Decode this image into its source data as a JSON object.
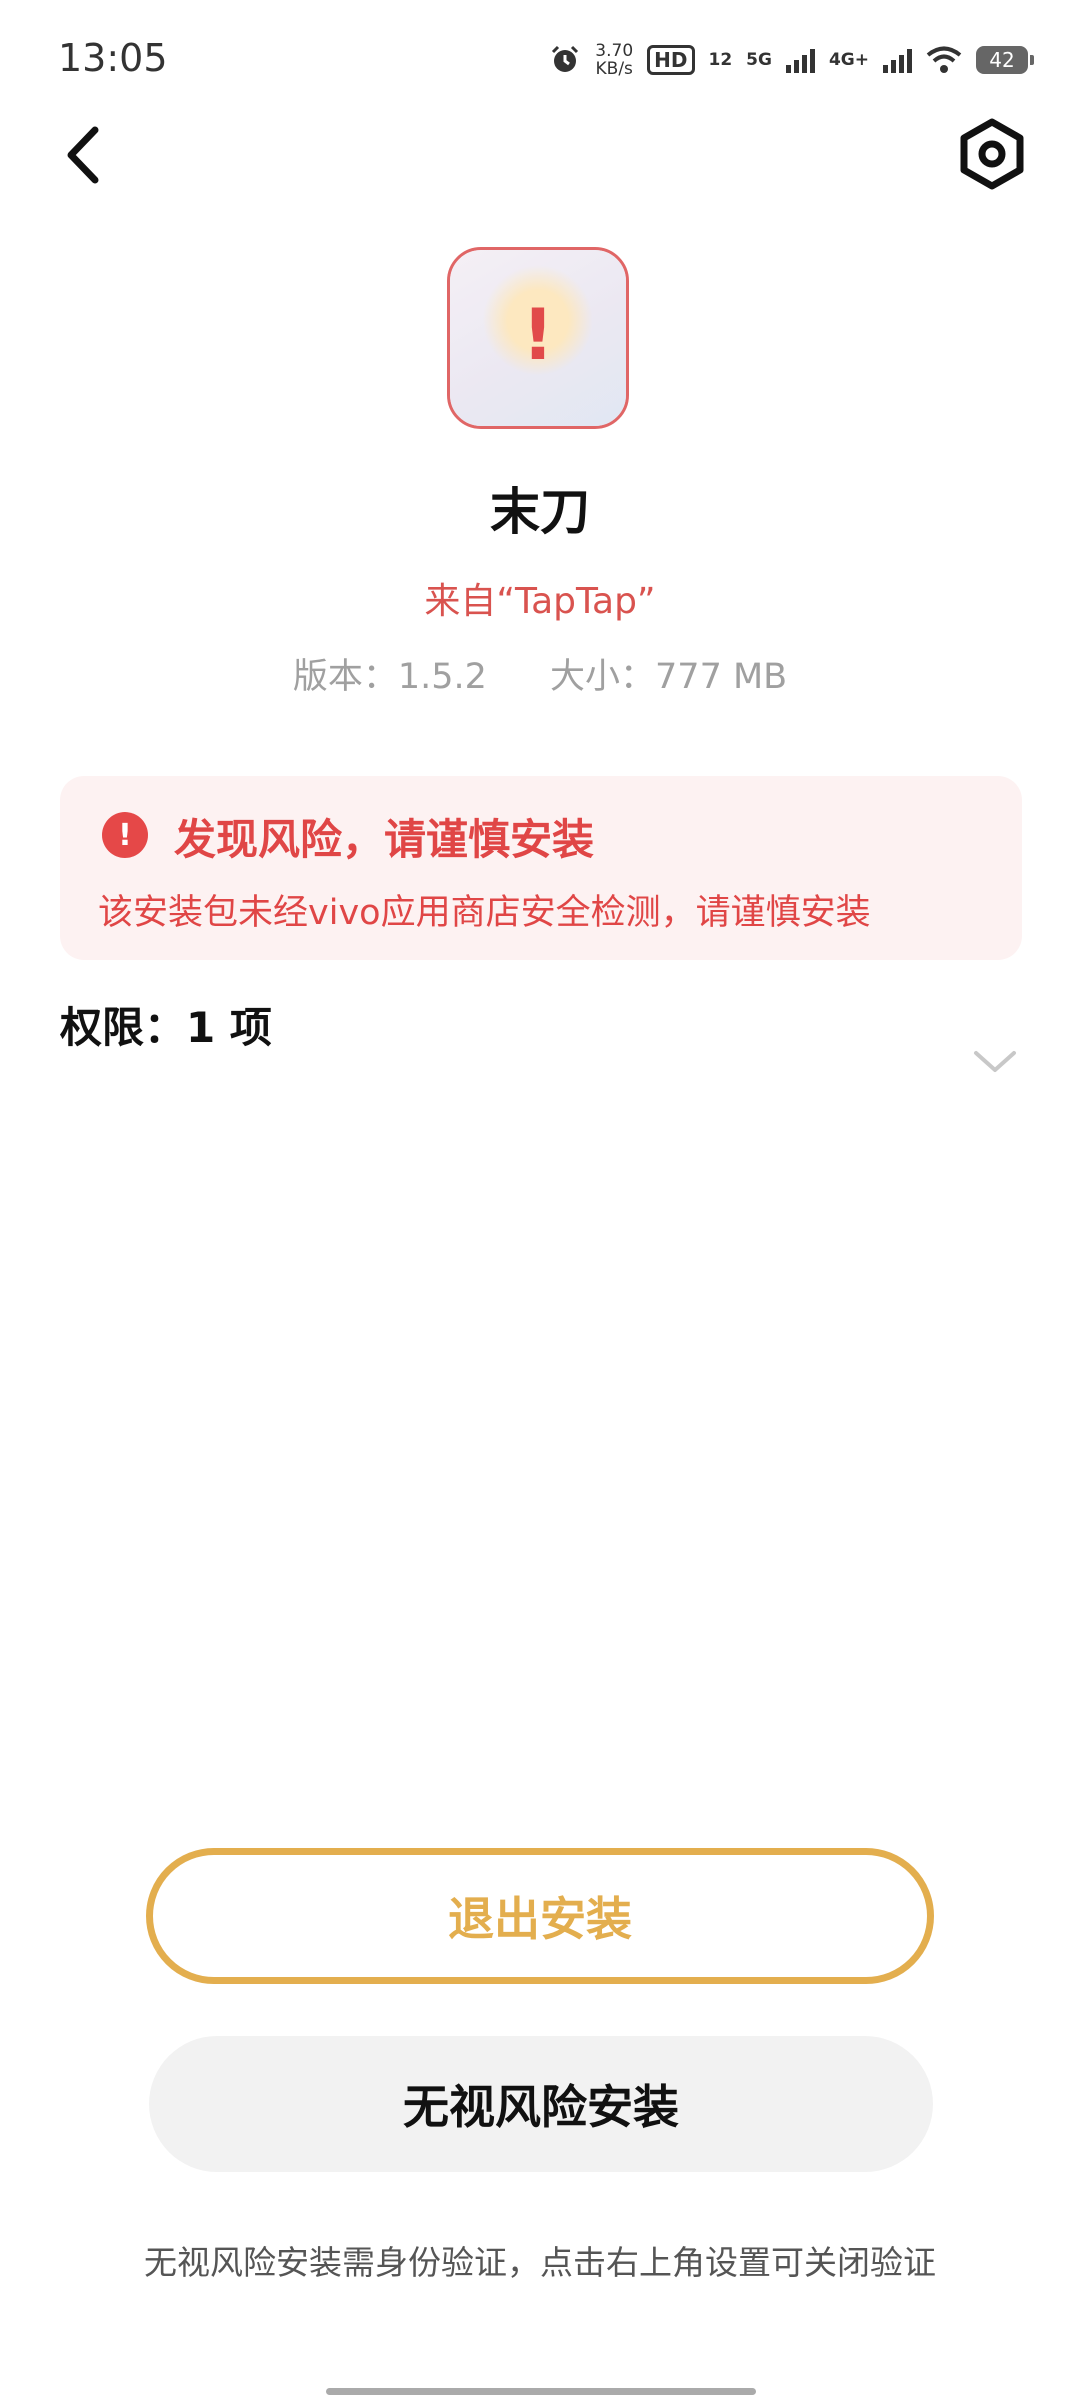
{
  "status_bar": {
    "time": "13:05",
    "net_speed_value": "3.70",
    "net_speed_unit": "KB/s",
    "hd_label": "HD",
    "hd_sub": "12",
    "sig1_label": "5G",
    "sig2_label": "4G+",
    "battery": "42"
  },
  "app": {
    "name": "末刀",
    "source": "来自“TapTap”",
    "version": "版本：1.5.2",
    "size": "大小：777 MB"
  },
  "risk": {
    "title": "发现风险，请谨慎安装",
    "description": "该安装包未经vivo应用商店安全检测，请谨慎安装"
  },
  "permissions": {
    "label": "权限：1 项"
  },
  "buttons": {
    "exit_install": "退出安装",
    "ignore_risk_install": "无视风险安装"
  },
  "footer_note": "无视风险安装需身份验证，点击右上角设置可关闭验证",
  "colors": {
    "risk_red": "#e04646",
    "accent_gold": "#e3ae4e",
    "card_bg": "#fdf2f2"
  },
  "icons": [
    "back-arrow",
    "settings-gear",
    "warning-exclamation",
    "chevron-down",
    "alarm-clock",
    "wifi"
  ]
}
